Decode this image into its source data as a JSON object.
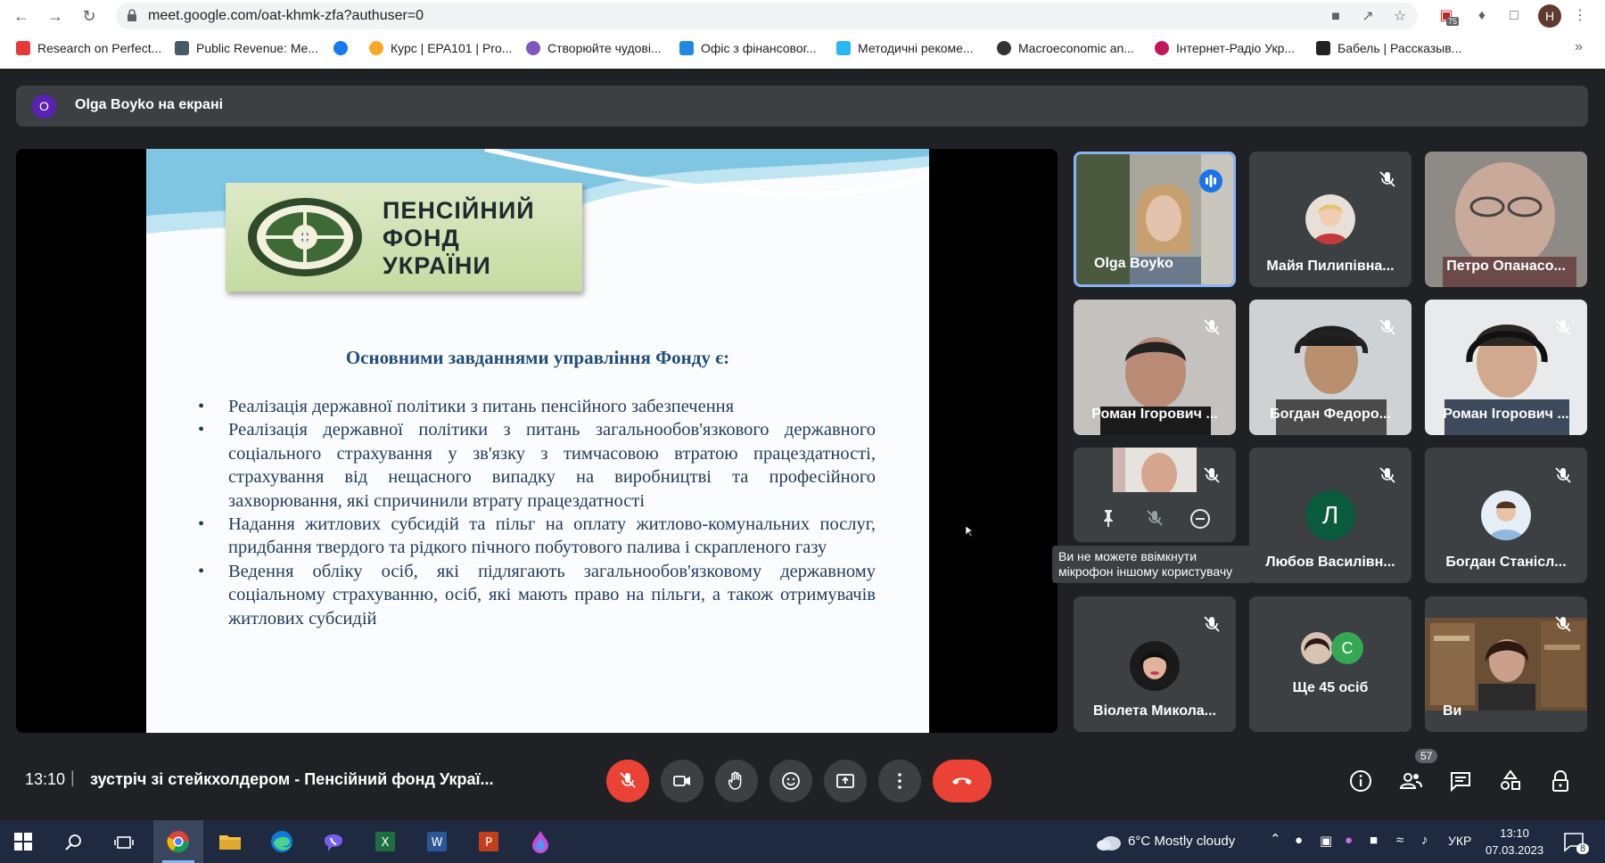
{
  "browser": {
    "url": "meet.google.com/oat-khmk-zfa?authuser=0",
    "profile_initial": "H",
    "extension_badge": "75",
    "bookmarks": [
      "Research on Perfect...",
      "Public Revenue: Me...",
      "Курс | EPA101 | Pro...",
      "Створюйте чудові...",
      "Офіс з фінансовог...",
      "Методичні рекоме...",
      "Macroeconomic an...",
      "Інтернет-Радіо Укр...",
      "Бабель | Рассказыв..."
    ],
    "more_bookmarks": "»"
  },
  "meet": {
    "presenter_initial": "O",
    "presenter_text": "Olga Boyko на екрані",
    "slide": {
      "logo_text": [
        "ПЕНСІЙНИЙ",
        "ФОНД",
        "УКРАЇНИ"
      ],
      "heading": "Основними завданнями управління Фонду є:",
      "bullets": [
        "Реалізація державної політики з питань пенсійного забезпечення",
        "Реалізація державної політики з питань загальнообов'язкового державного соціального страхування у зв'язку з тимчасовою втратою працездатності, страхування від нещасного випадку на виробництві та професійного захворювання, які спричинили втрату працездатності",
        "Надання житлових субсидій та пільг на оплату житлово-комунальних послуг, придбання твердого та рідкого пічного побутового палива і скрапленого газу",
        "Ведення обліку осіб, які підлягають загальнообов'язковому державному соціальному страхуванню, осіб, які мають право на пільги, а також отримувачів житлових субсидій"
      ]
    },
    "participants": [
      {
        "name": "Olga Boyko"
      },
      {
        "name": "Майя Пилипівна..."
      },
      {
        "name": "Петро Опанасо..."
      },
      {
        "name": "Роман Ігорович ..."
      },
      {
        "name": "Богдан Федоро..."
      },
      {
        "name": "Роман Ігорович ..."
      },
      {
        "name": ""
      },
      {
        "name": "Любов Василівн...",
        "initial": "Л"
      },
      {
        "name": "Богдан Станісл..."
      },
      {
        "name": "Віолета Микола..."
      },
      {
        "name": "Ще 45 осіб",
        "initial": "C"
      },
      {
        "name": "Ви"
      }
    ],
    "tooltip": "Ви не можете ввімкнути мікрофон іншому користувачу",
    "time": "13:10",
    "separator": "|",
    "meeting_title": "зустріч зі стейкхолдером - Пенсійний фонд Украї...",
    "people_count": "57"
  },
  "taskbar": {
    "weather": "6°C  Mostly cloudy",
    "lang": "УКР",
    "time": "13:10",
    "date": "07.03.2023",
    "notifications": "8"
  },
  "colors": {
    "meet_bg": "#202124",
    "tile_bg": "#3c4043",
    "red": "#ea4335",
    "accent": "#8ab4f8"
  }
}
